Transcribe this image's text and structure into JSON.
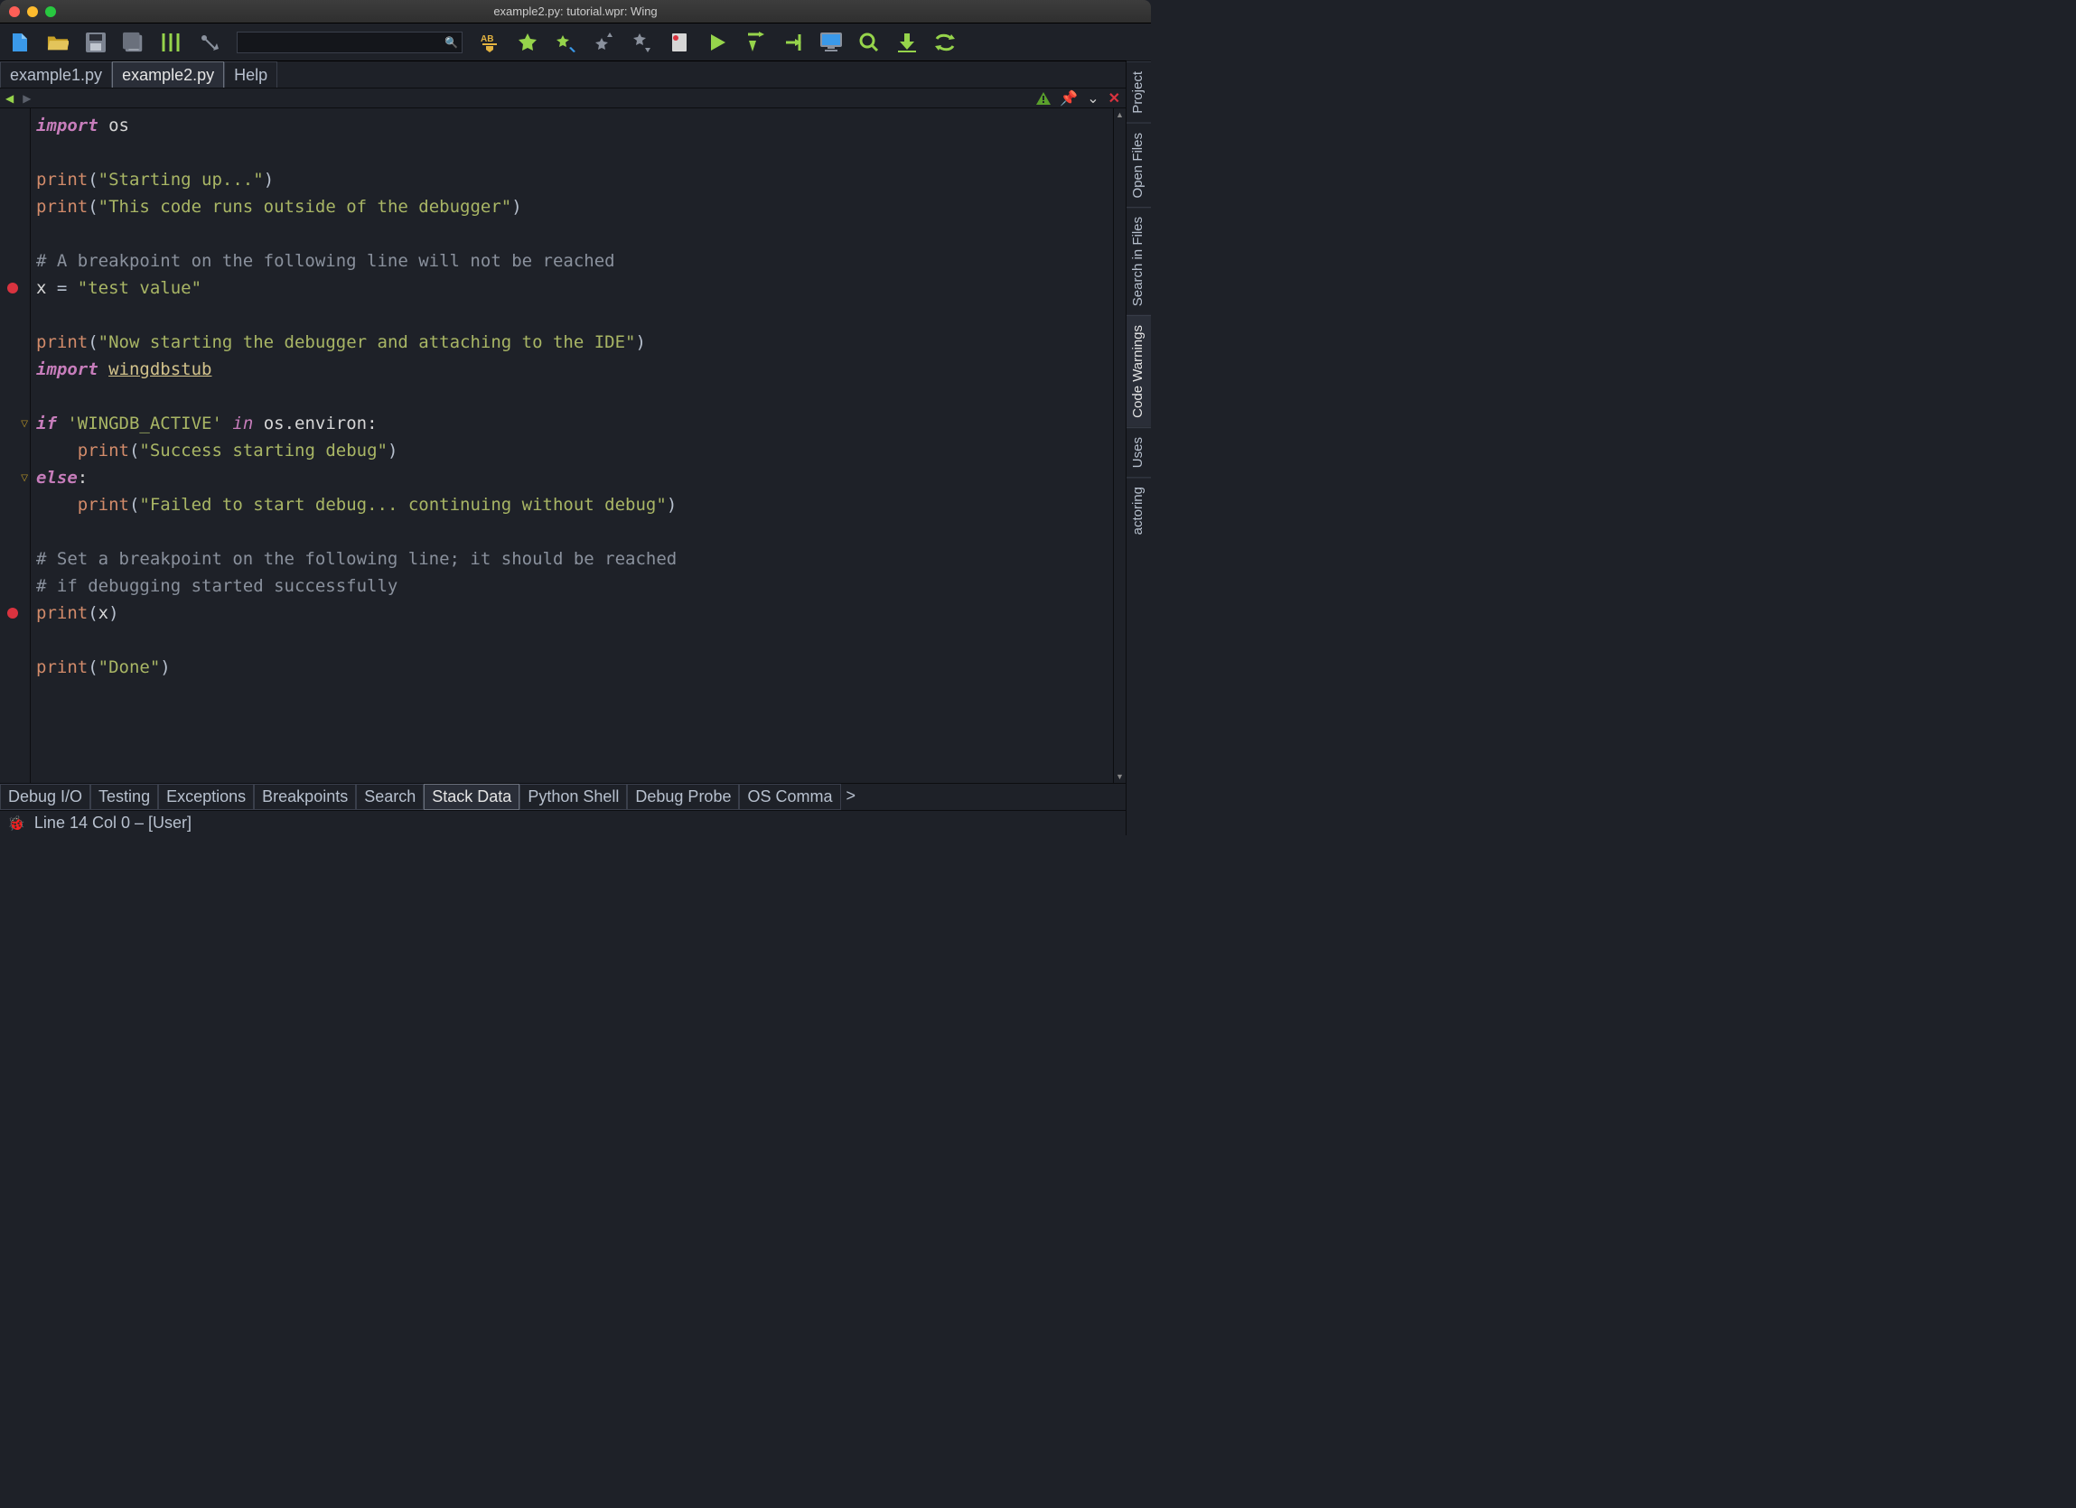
{
  "window": {
    "title": "example2.py: tutorial.wpr: Wing"
  },
  "toolbar": {
    "search_placeholder": ""
  },
  "file_tabs": {
    "items": [
      {
        "label": "example1.py",
        "active": false
      },
      {
        "label": "example2.py",
        "active": true
      },
      {
        "label": "Help",
        "active": false
      }
    ]
  },
  "editor": {
    "gutter": {
      "breakpoint_lines": [
        6,
        18
      ],
      "fold_lines": [
        11,
        13
      ]
    },
    "lines": [
      {
        "tokens": [
          {
            "cls": "kw",
            "t": "import"
          },
          {
            "cls": "",
            "t": " "
          },
          {
            "cls": "id",
            "t": "os"
          }
        ]
      },
      {
        "tokens": []
      },
      {
        "tokens": [
          {
            "cls": "fn",
            "t": "print"
          },
          {
            "cls": "",
            "t": "("
          },
          {
            "cls": "str",
            "t": "\"Starting up...\""
          },
          {
            "cls": "",
            "t": ")"
          }
        ]
      },
      {
        "tokens": [
          {
            "cls": "fn",
            "t": "print"
          },
          {
            "cls": "",
            "t": "("
          },
          {
            "cls": "str",
            "t": "\"This code runs outside of the debugger\""
          },
          {
            "cls": "",
            "t": ")"
          }
        ]
      },
      {
        "tokens": []
      },
      {
        "tokens": [
          {
            "cls": "cmt",
            "t": "# A breakpoint on the following line will not be reached"
          }
        ]
      },
      {
        "tokens": [
          {
            "cls": "id",
            "t": "x "
          },
          {
            "cls": "",
            "t": "= "
          },
          {
            "cls": "str",
            "t": "\"test value\""
          }
        ]
      },
      {
        "tokens": []
      },
      {
        "tokens": [
          {
            "cls": "fn",
            "t": "print"
          },
          {
            "cls": "",
            "t": "("
          },
          {
            "cls": "str",
            "t": "\"Now starting the debugger and attaching to the IDE\""
          },
          {
            "cls": "",
            "t": ")"
          }
        ]
      },
      {
        "tokens": [
          {
            "cls": "kw",
            "t": "import"
          },
          {
            "cls": "",
            "t": " "
          },
          {
            "cls": "mod und",
            "t": "wingdbstub"
          }
        ]
      },
      {
        "tokens": []
      },
      {
        "tokens": [
          {
            "cls": "kw",
            "t": "if"
          },
          {
            "cls": "",
            "t": " "
          },
          {
            "cls": "str",
            "t": "'WINGDB_ACTIVE'"
          },
          {
            "cls": "",
            "t": " "
          },
          {
            "cls": "op",
            "t": "in"
          },
          {
            "cls": "",
            "t": " "
          },
          {
            "cls": "id",
            "t": "os.environ:"
          }
        ]
      },
      {
        "tokens": [
          {
            "cls": "",
            "t": "    "
          },
          {
            "cls": "fn",
            "t": "print"
          },
          {
            "cls": "",
            "t": "("
          },
          {
            "cls": "str",
            "t": "\"Success starting debug\""
          },
          {
            "cls": "",
            "t": ")"
          }
        ]
      },
      {
        "tokens": [
          {
            "cls": "kw",
            "t": "else"
          },
          {
            "cls": "id",
            "t": ":"
          }
        ]
      },
      {
        "tokens": [
          {
            "cls": "",
            "t": "    "
          },
          {
            "cls": "fn",
            "t": "print"
          },
          {
            "cls": "",
            "t": "("
          },
          {
            "cls": "str",
            "t": "\"Failed to start debug... continuing without debug\""
          },
          {
            "cls": "",
            "t": ")"
          }
        ]
      },
      {
        "tokens": []
      },
      {
        "tokens": [
          {
            "cls": "cmt",
            "t": "# Set a breakpoint on the following line; it should be reached"
          }
        ]
      },
      {
        "tokens": [
          {
            "cls": "cmt",
            "t": "# if debugging started successfully"
          }
        ]
      },
      {
        "tokens": [
          {
            "cls": "fn",
            "t": "print"
          },
          {
            "cls": "",
            "t": "("
          },
          {
            "cls": "id",
            "t": "x"
          },
          {
            "cls": "",
            "t": ")"
          }
        ]
      },
      {
        "tokens": []
      },
      {
        "tokens": [
          {
            "cls": "fn",
            "t": "print"
          },
          {
            "cls": "",
            "t": "("
          },
          {
            "cls": "str",
            "t": "\"Done\""
          },
          {
            "cls": "",
            "t": ")"
          }
        ]
      },
      {
        "tokens": []
      },
      {
        "tokens": []
      }
    ]
  },
  "side_tabs": {
    "items": [
      {
        "label": "Project"
      },
      {
        "label": "Open Files"
      },
      {
        "label": "Search in Files"
      },
      {
        "label": "Code Warnings",
        "active": true
      },
      {
        "label": "Uses"
      },
      {
        "label": "actoring"
      }
    ]
  },
  "bottom_tabs": {
    "items": [
      {
        "label": "Debug I/O"
      },
      {
        "label": "Testing"
      },
      {
        "label": "Exceptions"
      },
      {
        "label": "Breakpoints"
      },
      {
        "label": "Search"
      },
      {
        "label": "Stack Data",
        "active": true
      },
      {
        "label": "Python Shell"
      },
      {
        "label": "Debug Probe"
      },
      {
        "label": "OS Comma"
      }
    ],
    "more_indicator": ">"
  },
  "statusbar": {
    "text": "Line 14 Col 0 – [User]"
  },
  "colors": {
    "accent_green": "#96d44b",
    "accent_yellow": "#e3b341",
    "accent_red": "#d9333f"
  }
}
